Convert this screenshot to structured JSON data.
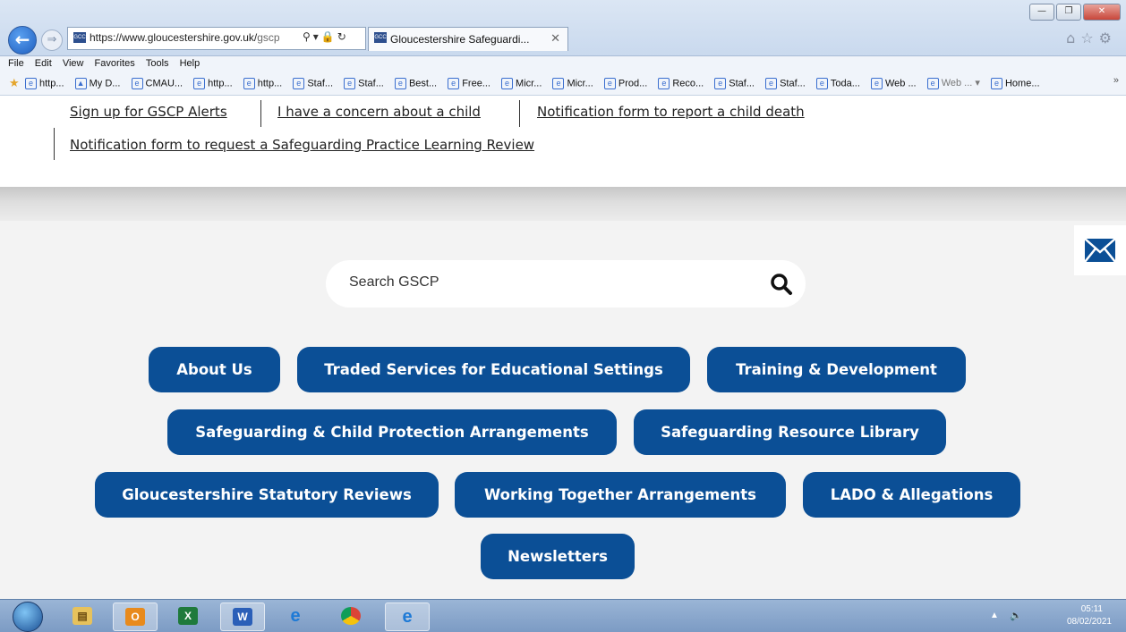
{
  "browser": {
    "url_host": "https://www.gloucestershire.gov.uk/",
    "url_path": "gscp",
    "favicon_text": "GCC",
    "tab_title": "Gloucestershire Safeguardi...",
    "menu": [
      "File",
      "Edit",
      "View",
      "Favorites",
      "Tools",
      "Help"
    ],
    "favorites": [
      "http...",
      "My D...",
      "CMAU...",
      "http...",
      "http...",
      "Staf...",
      "Staf...",
      "Best...",
      "Free...",
      "Micr...",
      "Micr...",
      "Prod...",
      "Reco...",
      "Staf...",
      "Staf...",
      "Toda...",
      "Web ...",
      "Web ... ▾",
      "Home..."
    ]
  },
  "toplinks": {
    "alerts": "Sign up for GSCP Alerts",
    "concern": "I have a concern about a child",
    "death": "Notification form to report a child death",
    "review": "Notification form to request a Safeguarding Practice Learning Review"
  },
  "search": {
    "placeholder": "Search GSCP"
  },
  "nav_buttons": {
    "about": "About Us",
    "traded": "Traded Services for Educational Settings",
    "training": "Training & Development",
    "arrangements": "Safeguarding & Child Protection Arrangements",
    "library": "Safeguarding Resource Library",
    "reviews": "Gloucestershire Statutory Reviews",
    "working": "Working Together Arrangements",
    "lado": "LADO & Allegations",
    "newsletters": "Newsletters"
  },
  "taskbar": {
    "time": "05:11",
    "date": "08/02/2021"
  },
  "colors": {
    "button_blue": "#0b4f96"
  }
}
